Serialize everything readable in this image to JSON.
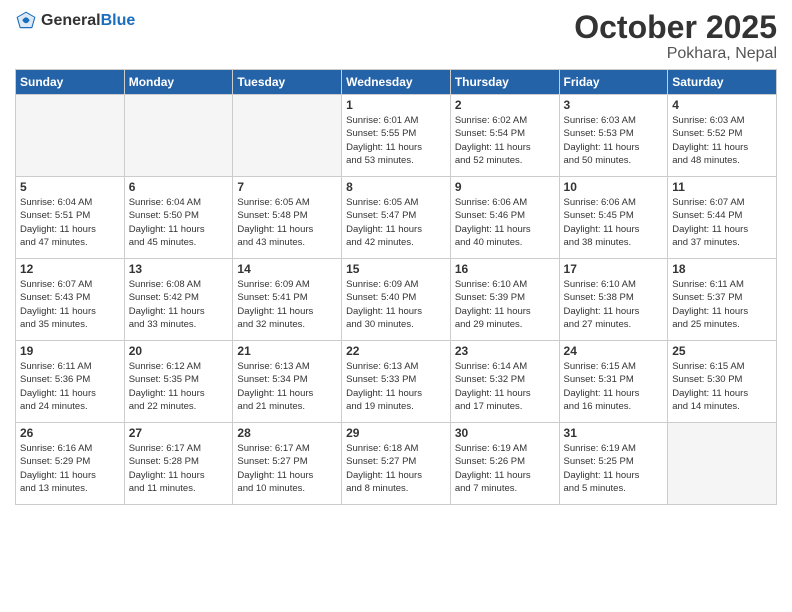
{
  "header": {
    "logo_general": "General",
    "logo_blue": "Blue",
    "month": "October 2025",
    "location": "Pokhara, Nepal"
  },
  "weekdays": [
    "Sunday",
    "Monday",
    "Tuesday",
    "Wednesday",
    "Thursday",
    "Friday",
    "Saturday"
  ],
  "weeks": [
    [
      {
        "day": "",
        "info": ""
      },
      {
        "day": "",
        "info": ""
      },
      {
        "day": "",
        "info": ""
      },
      {
        "day": "1",
        "info": "Sunrise: 6:01 AM\nSunset: 5:55 PM\nDaylight: 11 hours\nand 53 minutes."
      },
      {
        "day": "2",
        "info": "Sunrise: 6:02 AM\nSunset: 5:54 PM\nDaylight: 11 hours\nand 52 minutes."
      },
      {
        "day": "3",
        "info": "Sunrise: 6:03 AM\nSunset: 5:53 PM\nDaylight: 11 hours\nand 50 minutes."
      },
      {
        "day": "4",
        "info": "Sunrise: 6:03 AM\nSunset: 5:52 PM\nDaylight: 11 hours\nand 48 minutes."
      }
    ],
    [
      {
        "day": "5",
        "info": "Sunrise: 6:04 AM\nSunset: 5:51 PM\nDaylight: 11 hours\nand 47 minutes."
      },
      {
        "day": "6",
        "info": "Sunrise: 6:04 AM\nSunset: 5:50 PM\nDaylight: 11 hours\nand 45 minutes."
      },
      {
        "day": "7",
        "info": "Sunrise: 6:05 AM\nSunset: 5:48 PM\nDaylight: 11 hours\nand 43 minutes."
      },
      {
        "day": "8",
        "info": "Sunrise: 6:05 AM\nSunset: 5:47 PM\nDaylight: 11 hours\nand 42 minutes."
      },
      {
        "day": "9",
        "info": "Sunrise: 6:06 AM\nSunset: 5:46 PM\nDaylight: 11 hours\nand 40 minutes."
      },
      {
        "day": "10",
        "info": "Sunrise: 6:06 AM\nSunset: 5:45 PM\nDaylight: 11 hours\nand 38 minutes."
      },
      {
        "day": "11",
        "info": "Sunrise: 6:07 AM\nSunset: 5:44 PM\nDaylight: 11 hours\nand 37 minutes."
      }
    ],
    [
      {
        "day": "12",
        "info": "Sunrise: 6:07 AM\nSunset: 5:43 PM\nDaylight: 11 hours\nand 35 minutes."
      },
      {
        "day": "13",
        "info": "Sunrise: 6:08 AM\nSunset: 5:42 PM\nDaylight: 11 hours\nand 33 minutes."
      },
      {
        "day": "14",
        "info": "Sunrise: 6:09 AM\nSunset: 5:41 PM\nDaylight: 11 hours\nand 32 minutes."
      },
      {
        "day": "15",
        "info": "Sunrise: 6:09 AM\nSunset: 5:40 PM\nDaylight: 11 hours\nand 30 minutes."
      },
      {
        "day": "16",
        "info": "Sunrise: 6:10 AM\nSunset: 5:39 PM\nDaylight: 11 hours\nand 29 minutes."
      },
      {
        "day": "17",
        "info": "Sunrise: 6:10 AM\nSunset: 5:38 PM\nDaylight: 11 hours\nand 27 minutes."
      },
      {
        "day": "18",
        "info": "Sunrise: 6:11 AM\nSunset: 5:37 PM\nDaylight: 11 hours\nand 25 minutes."
      }
    ],
    [
      {
        "day": "19",
        "info": "Sunrise: 6:11 AM\nSunset: 5:36 PM\nDaylight: 11 hours\nand 24 minutes."
      },
      {
        "day": "20",
        "info": "Sunrise: 6:12 AM\nSunset: 5:35 PM\nDaylight: 11 hours\nand 22 minutes."
      },
      {
        "day": "21",
        "info": "Sunrise: 6:13 AM\nSunset: 5:34 PM\nDaylight: 11 hours\nand 21 minutes."
      },
      {
        "day": "22",
        "info": "Sunrise: 6:13 AM\nSunset: 5:33 PM\nDaylight: 11 hours\nand 19 minutes."
      },
      {
        "day": "23",
        "info": "Sunrise: 6:14 AM\nSunset: 5:32 PM\nDaylight: 11 hours\nand 17 minutes."
      },
      {
        "day": "24",
        "info": "Sunrise: 6:15 AM\nSunset: 5:31 PM\nDaylight: 11 hours\nand 16 minutes."
      },
      {
        "day": "25",
        "info": "Sunrise: 6:15 AM\nSunset: 5:30 PM\nDaylight: 11 hours\nand 14 minutes."
      }
    ],
    [
      {
        "day": "26",
        "info": "Sunrise: 6:16 AM\nSunset: 5:29 PM\nDaylight: 11 hours\nand 13 minutes."
      },
      {
        "day": "27",
        "info": "Sunrise: 6:17 AM\nSunset: 5:28 PM\nDaylight: 11 hours\nand 11 minutes."
      },
      {
        "day": "28",
        "info": "Sunrise: 6:17 AM\nSunset: 5:27 PM\nDaylight: 11 hours\nand 10 minutes."
      },
      {
        "day": "29",
        "info": "Sunrise: 6:18 AM\nSunset: 5:27 PM\nDaylight: 11 hours\nand 8 minutes."
      },
      {
        "day": "30",
        "info": "Sunrise: 6:19 AM\nSunset: 5:26 PM\nDaylight: 11 hours\nand 7 minutes."
      },
      {
        "day": "31",
        "info": "Sunrise: 6:19 AM\nSunset: 5:25 PM\nDaylight: 11 hours\nand 5 minutes."
      },
      {
        "day": "",
        "info": ""
      }
    ]
  ]
}
